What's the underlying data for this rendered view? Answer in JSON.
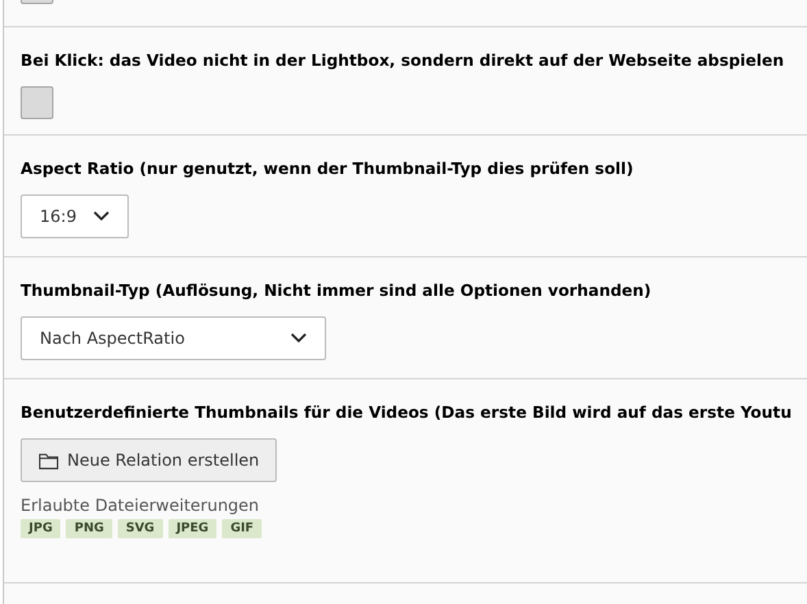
{
  "sections": [
    {
      "kind": "checkbox",
      "checked": false
    },
    {
      "kind": "checkbox",
      "label": "Bei Klick: das Video nicht in der Lightbox, sondern direkt auf der Webseite abspielen",
      "checked": false
    },
    {
      "kind": "select",
      "label": "Aspect Ratio (nur genutzt, wenn der Thumbnail-Typ dies prüfen soll)",
      "value": "16:9"
    },
    {
      "kind": "select",
      "label": "Thumbnail-Typ (Auflösung, Nicht immer sind alle Optionen vorhanden)",
      "value": "Nach AspectRatio"
    },
    {
      "kind": "files",
      "label": "Benutzerdefinierte Thumbnails für die Videos (Das erste Bild wird auf das erste Youtu",
      "button": "Neue Relation erstellen",
      "hint": "Erlaubte Dateierweiterungen",
      "extensions": [
        "JPG",
        "PNG",
        "SVG",
        "JPEG",
        "GIF"
      ]
    }
  ]
}
